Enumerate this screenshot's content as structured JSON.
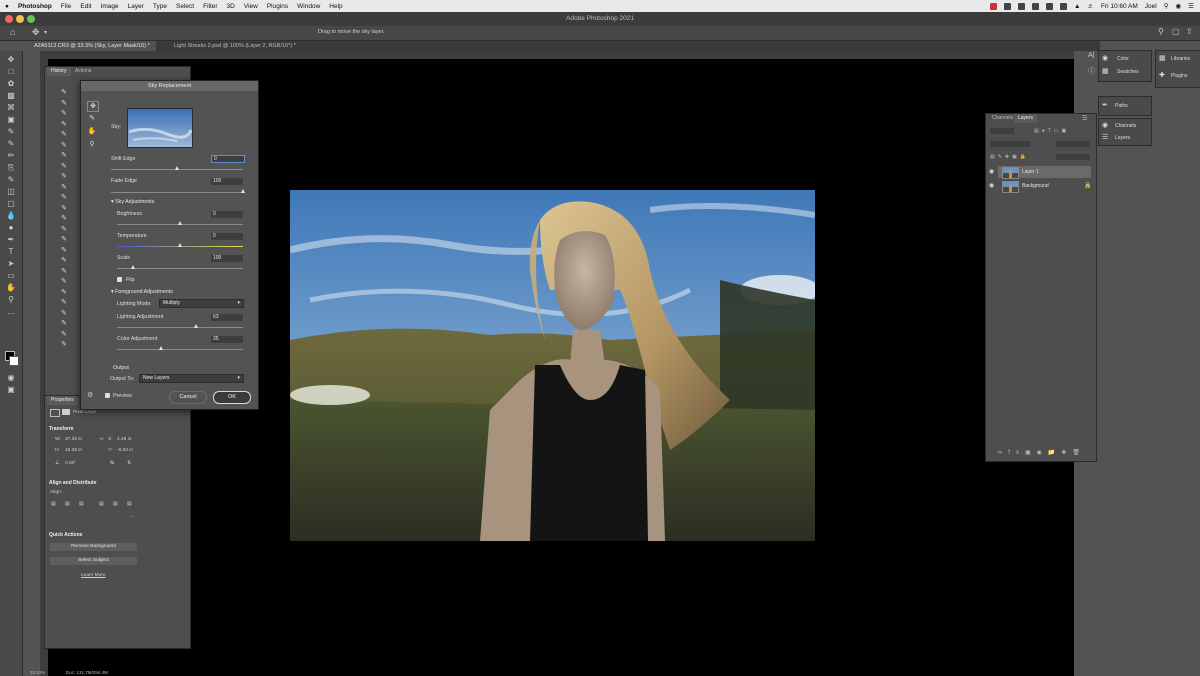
{
  "menubar": {
    "items": [
      "Photoshop",
      "File",
      "Edit",
      "Image",
      "Layer",
      "Type",
      "Select",
      "Filter",
      "3D",
      "View",
      "Plugins",
      "Window",
      "Help"
    ],
    "clock": "Fri 10:60 AM",
    "user": "Joel"
  },
  "titlebar": {
    "title": "Adobe Photoshop 2021"
  },
  "options": {
    "hint": "Drag to move the sky layer."
  },
  "doc_tabs": [
    {
      "label": "A2A5113.CR3 @ 33.3% (Sky, Layer Mask/16) *"
    },
    {
      "label": "Light Streaks 2.psd @ 100% (Layer 2, RGB/16*) *"
    }
  ],
  "history": {
    "tabs": [
      "History",
      "Actions"
    ]
  },
  "sky_dialog": {
    "title": "Sky Replacement",
    "sky_label": "Sky:",
    "shift_edge": {
      "label": "Shift Edge",
      "value": "0",
      "pct": 0.5
    },
    "fade_edge": {
      "label": "Fade Edge",
      "value": "100",
      "pct": 1.0
    },
    "sky_adjustments": {
      "title": "Sky Adjustments",
      "brightness": {
        "label": "Brightness",
        "value": "0",
        "pct": 0.5
      },
      "temperature": {
        "label": "Temperature",
        "value": "0",
        "pct": 0.5
      },
      "scale": {
        "label": "Scale",
        "value": "100",
        "pct": 0.13
      },
      "flip_label": "Flip"
    },
    "foreground_adjustments": {
      "title": "Foreground Adjustments",
      "lighting_mode_label": "Lighting Mode:",
      "lighting_mode_value": "Multiply",
      "lighting_adjustment": {
        "label": "Lighting Adjustment",
        "value": "63",
        "pct": 0.63
      },
      "color_adjustment": {
        "label": "Color Adjustment",
        "value": "35",
        "pct": 0.35
      }
    },
    "output": {
      "title": "Output",
      "output_to_label": "Output To:",
      "output_to_value": "New Layers"
    },
    "preview_label": "Preview",
    "cancel_label": "Cancel",
    "ok_label": "OK"
  },
  "properties": {
    "tab": "Properties",
    "kind": "Pixel Layer",
    "transform": {
      "title": "Transform",
      "w": "37.36 in",
      "h": "18.36 in",
      "x": "4.48 in",
      "y": "-6.03 in",
      "angle": "0.00°"
    },
    "align_title": "Align and Distribute",
    "align_label": "Align:",
    "quick_actions_title": "Quick Actions",
    "remove_bg": "Remove Background",
    "select_subject": "Select Subject",
    "learn_more": "Learn More"
  },
  "layers_panel": {
    "tabs": [
      "Channels",
      "Layers"
    ],
    "layers": [
      {
        "name": "Layer 1"
      },
      {
        "name": "Background"
      }
    ]
  },
  "right_panels": {
    "color": "Color",
    "swatches": "Swatches",
    "paths": "Paths",
    "channels": "Channels",
    "layers": "Layers",
    "libraries": "Libraries",
    "plugins": "Plugins"
  },
  "status": {
    "zoom": "33.33%",
    "doc": "Doc: 131.7M/294.4M"
  },
  "colors": {
    "app_bg": "#535353",
    "panel_bg": "#4e4e4e",
    "canvas_bg": "#000000",
    "ok_button": "#3a3a3a",
    "accent_blue": "#5b8fd4"
  }
}
